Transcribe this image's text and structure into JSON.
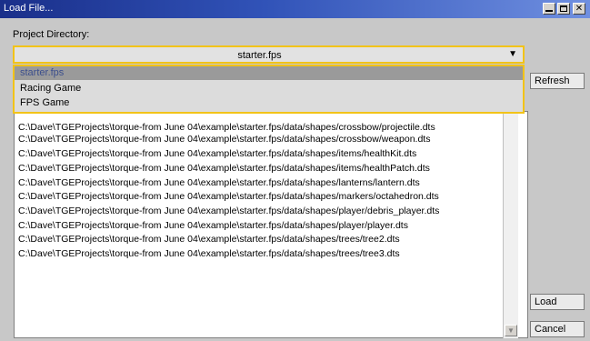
{
  "window": {
    "title": "Load File...",
    "buttons": [
      "minimize",
      "maximize",
      "close"
    ]
  },
  "project_directory": {
    "label": "Project Directory:",
    "selected": "starter.fps",
    "arrow": "▼",
    "options": [
      "starter.fps",
      "Racing Game",
      "FPS Game"
    ]
  },
  "buttons": {
    "refresh": "Refresh",
    "load": "Load",
    "cancel": "Cancel"
  },
  "files": [
    "C:\\Dave\\TGEProjects\\torque-from June 04\\example\\starter.fps/data/shapes/crossbow/projectile.dts",
    "C:\\Dave\\TGEProjects\\torque-from June 04\\example\\starter.fps/data/shapes/crossbow/weapon.dts",
    "C:\\Dave\\TGEProjects\\torque-from June 04\\example\\starter.fps/data/shapes/items/healthKit.dts",
    "C:\\Dave\\TGEProjects\\torque-from June 04\\example\\starter.fps/data/shapes/items/healthPatch.dts",
    "C:\\Dave\\TGEProjects\\torque-from June 04\\example\\starter.fps/data/shapes/lanterns/lantern.dts",
    "C:\\Dave\\TGEProjects\\torque-from June 04\\example\\starter.fps/data/shapes/markers/octahedron.dts",
    "C:\\Dave\\TGEProjects\\torque-from June 04\\example\\starter.fps/data/shapes/player/debris_player.dts",
    "C:\\Dave\\TGEProjects\\torque-from June 04\\example\\starter.fps/data/shapes/player/player.dts",
    "C:\\Dave\\TGEProjects\\torque-from June 04\\example\\starter.fps/data/shapes/trees/tree2.dts",
    "C:\\Dave\\TGEProjects\\torque-from June 04\\example\\starter.fps/data/shapes/trees/tree3.dts"
  ],
  "colors": {
    "title_gradient_start": "#1a2f8a",
    "title_gradient_end": "#6f8fe0",
    "focus_border": "#f2c318",
    "selected_item_bg": "#9a9a9a",
    "selected_item_text": "#3b4e8c"
  },
  "icons": {
    "minimize": "minimize-icon",
    "maximize": "maximize-icon",
    "close": "close-icon",
    "scroll_down": "scroll-down-arrow-icon",
    "dropdown": "chevron-down-icon"
  }
}
